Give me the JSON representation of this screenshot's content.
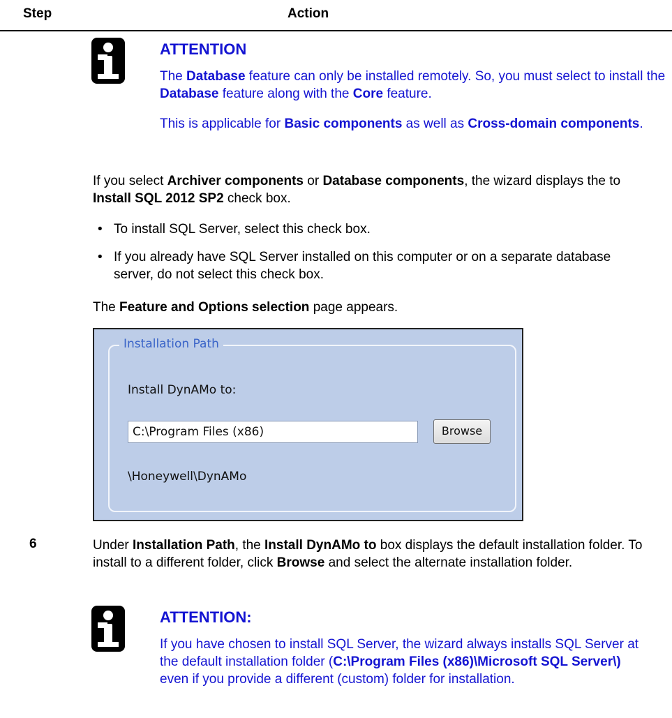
{
  "header": {
    "step_label": "Step",
    "action_label": "Action"
  },
  "attention1": {
    "title": "ATTENTION",
    "p1": [
      {
        "t": "The ",
        "b": false
      },
      {
        "t": "Database",
        "b": true
      },
      {
        "t": " feature can only be installed remotely. So, you must select to install the ",
        "b": false
      },
      {
        "t": "Database",
        "b": true
      },
      {
        "t": " feature along with the ",
        "b": false
      },
      {
        "t": "Core",
        "b": true
      },
      {
        "t": " feature.",
        "b": false
      }
    ],
    "p2": [
      {
        "t": "This is applicable for ",
        "b": false
      },
      {
        "t": "Basic components",
        "b": true
      },
      {
        "t": " as well as ",
        "b": false
      },
      {
        "t": "Cross-domain components",
        "b": true
      },
      {
        "t": ".",
        "b": false
      }
    ]
  },
  "archiver_para": [
    {
      "t": "If you select ",
      "b": false
    },
    {
      "t": "Archiver components",
      "b": true
    },
    {
      "t": " or ",
      "b": false
    },
    {
      "t": "Database components",
      "b": true
    },
    {
      "t": ", the wizard displays the to ",
      "b": false
    },
    {
      "t": "Install SQL 2012 SP2",
      "b": true
    },
    {
      "t": " check box.",
      "b": false
    }
  ],
  "bullets": [
    "To install SQL Server, select this check box.",
    "If you already have SQL Server installed on this computer or on a separate database server, do not select this check box."
  ],
  "bullet_char": "•",
  "feature_para": [
    {
      "t": "The ",
      "b": false
    },
    {
      "t": "Feature and Options selection",
      "b": true
    },
    {
      "t": " page appears.",
      "b": false
    }
  ],
  "screenshot": {
    "group_title": "Installation Path",
    "install_label": "Install DynAMo to:",
    "path_value": "C:\\Program Files (x86)",
    "browse_label": "Browse",
    "path_suffix": "\\Honeywell\\DynAMo"
  },
  "step6": {
    "number": "6",
    "text": [
      {
        "t": "Under ",
        "b": false
      },
      {
        "t": "Installation Path",
        "b": true
      },
      {
        "t": ", the ",
        "b": false
      },
      {
        "t": "Install DynAMo to",
        "b": true
      },
      {
        "t": " box displays the default installation folder. To install to a different folder, click ",
        "b": false
      },
      {
        "t": "Browse",
        "b": true
      },
      {
        "t": " and select the alternate installation folder.",
        "b": false
      }
    ]
  },
  "attention2": {
    "title": "ATTENTION:",
    "text": [
      {
        "t": "If you have chosen to install SQL Server, the wizard always installs SQL Server at the default installation folder (",
        "b": false
      },
      {
        "t": "C:\\Program Files (x86)\\Microsoft SQL Server\\)",
        "b": true
      },
      {
        "t": " even if you provide a different (custom) folder for installation.",
        "b": false
      }
    ]
  },
  "colors": {
    "attention_blue": "#1414d2",
    "panel_bg": "#bdcde8",
    "legend_blue": "#3a64c8"
  },
  "icons": [
    "info-icon"
  ]
}
